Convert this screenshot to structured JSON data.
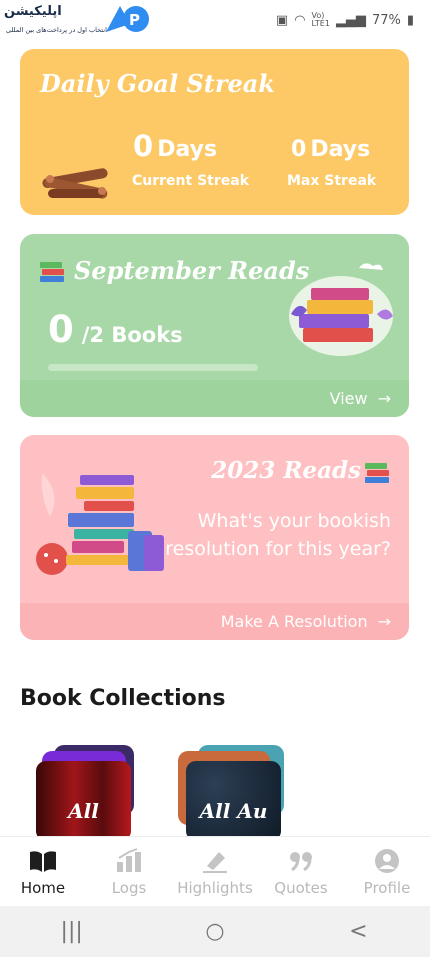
{
  "status_bar": {
    "logo_text": "اپلیکیشن",
    "logo_subtitle": "انتخاب اول در پرداخت‌های بین المللی",
    "network_top": "Vo)",
    "network_bottom": "LTE1",
    "battery": "77%"
  },
  "streak_card": {
    "title": "Daily Goal Streak",
    "current_value": "0",
    "current_unit": "Days",
    "current_label": "Current Streak",
    "max_value": "0",
    "max_unit": "Days",
    "max_label": "Max Streak",
    "bg_color": "#fdc966"
  },
  "month_card": {
    "title": "September Reads",
    "books_read": "0",
    "books_goal": "/2 Books",
    "progress_fraction": 0.0,
    "footer_link": "View",
    "bg_color": "#a9d8a8"
  },
  "year_card": {
    "title": "2023 Reads",
    "prompt": "What's your bookish resolution for this year?",
    "footer_link": "Make A Resolution",
    "bg_color": "#fec0c2"
  },
  "collections": {
    "title": "Book Collections",
    "items": [
      {
        "label": "All"
      },
      {
        "label": "All Au"
      }
    ]
  },
  "bottom_nav": {
    "items": [
      {
        "label": "Home",
        "icon": "book-open-icon",
        "active": true
      },
      {
        "label": "Logs",
        "icon": "bar-chart-icon",
        "active": false
      },
      {
        "label": "Highlights",
        "icon": "highlighter-icon",
        "active": false
      },
      {
        "label": "Quotes",
        "icon": "quote-icon",
        "active": false
      },
      {
        "label": "Profile",
        "icon": "user-icon",
        "active": false
      }
    ]
  },
  "system_nav": {
    "recents": "|||",
    "home": "○",
    "back": "<"
  }
}
